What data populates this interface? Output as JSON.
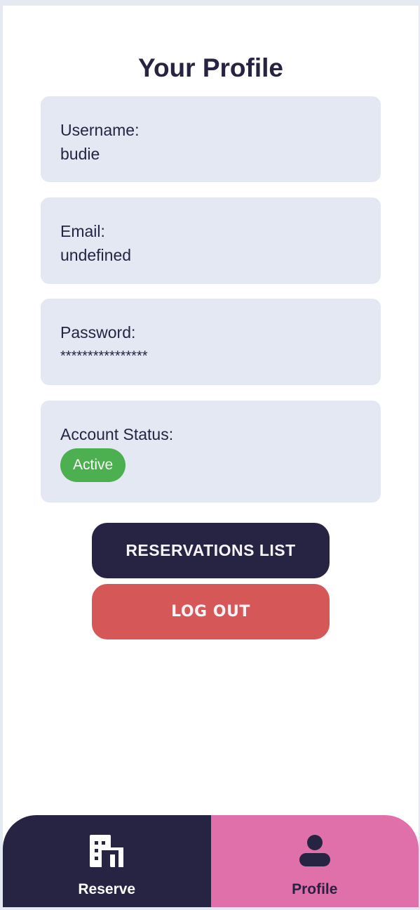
{
  "page": {
    "title": "Your Profile"
  },
  "profile": {
    "username_label": "Username:",
    "username_value": "budie",
    "email_label": "Email:",
    "email_value": "undefined",
    "password_label": "Password:",
    "password_value": "****************",
    "status_label": "Account Status:",
    "status_value": "Active"
  },
  "actions": {
    "reservations_label": "RESERVATIONS LIST",
    "logout_label": "LOG OUT"
  },
  "nav": {
    "reserve_label": "Reserve",
    "reserve_icon": "building-icon",
    "profile_label": "Profile",
    "profile_icon": "user-icon",
    "active": "Profile"
  },
  "colors": {
    "primary": "#272343",
    "card": "#e4e8f3",
    "status_active": "#4caf50",
    "logout": "#d65757",
    "nav_active": "#e070aa"
  }
}
